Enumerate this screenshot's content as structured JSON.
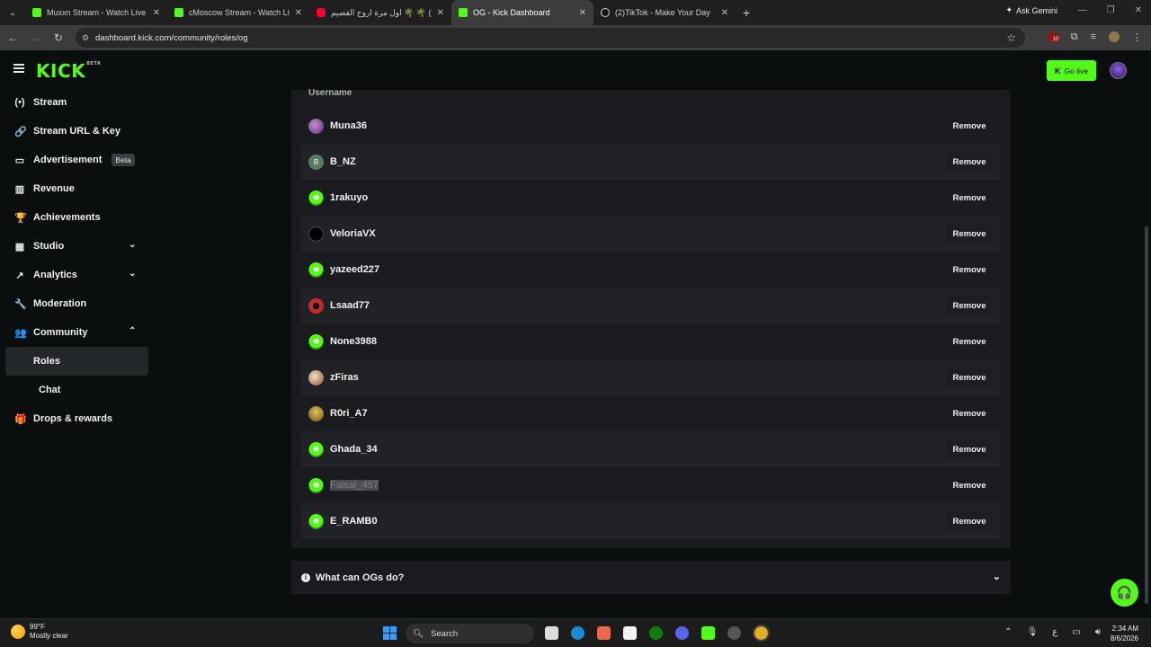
{
  "browser": {
    "tabs": [
      {
        "title": "Muxxn Stream - Watch Live on",
        "favicon": "kick",
        "active": false
      },
      {
        "title": "cMoscow Stream - Watch Live o",
        "favicon": "kick",
        "active": false
      },
      {
        "title": "اول مرة اروح القصيم ‎🌴 🌴 ‎(1)",
        "favicon": "yt",
        "active": false
      },
      {
        "title": "OG - Kick Dashboard",
        "favicon": "kick",
        "active": true
      },
      {
        "title": "(2)TikTok - Make Your Day",
        "favicon": "tt",
        "active": false
      }
    ],
    "new_tab": "+",
    "gemini_label": "Ask Gemini",
    "url": "dashboard.kick.com/community/roles/og",
    "extension_badge": "10"
  },
  "app": {
    "logo_text": "KICK",
    "logo_badge": "BETA",
    "go_live_label": "Go live",
    "sidebar": [
      {
        "label": "Stream",
        "icon": "broadcast-icon",
        "glyph": "(•)"
      },
      {
        "label": "Stream URL & Key",
        "icon": "link-icon",
        "glyph": "🔗"
      },
      {
        "label": "Advertisement",
        "icon": "ad-window-icon",
        "glyph": "▭",
        "badge": "Beta"
      },
      {
        "label": "Revenue",
        "icon": "bar-chart-icon",
        "glyph": "▥"
      },
      {
        "label": "Achievements",
        "icon": "trophy-icon",
        "glyph": "🏆"
      },
      {
        "label": "Studio",
        "icon": "studio-icon",
        "glyph": "▦",
        "chevron": "down"
      },
      {
        "label": "Analytics",
        "icon": "analytics-icon",
        "glyph": "↗",
        "chevron": "down"
      },
      {
        "label": "Moderation",
        "icon": "wrench-icon",
        "glyph": "🔧"
      },
      {
        "label": "Community",
        "icon": "community-icon",
        "glyph": "👥",
        "chevron": "up"
      }
    ],
    "community_sub": [
      {
        "label": "Roles",
        "active": true
      },
      {
        "label": "Chat",
        "active": false
      }
    ],
    "sidebar_tail": {
      "label": "Drops & rewards",
      "icon": "gift-icon",
      "glyph": "🎁"
    },
    "table": {
      "column_header": "Username",
      "remove_label": "Remove",
      "rows": [
        {
          "username": "Muna36",
          "avatar": "purple"
        },
        {
          "username": "B_NZ",
          "avatar": "b",
          "initial": "B"
        },
        {
          "username": "1rakuyo",
          "avatar": "def"
        },
        {
          "username": "VeloriaVX",
          "avatar": "dark"
        },
        {
          "username": "yazeed227",
          "avatar": "def"
        },
        {
          "username": "Lsaad77",
          "avatar": "red"
        },
        {
          "username": "None3988",
          "avatar": "def"
        },
        {
          "username": "zFiras",
          "avatar": "fire"
        },
        {
          "username": "R0ri_A7",
          "avatar": "gold"
        },
        {
          "username": "Ghada_34",
          "avatar": "def"
        },
        {
          "username": "Faisal_457",
          "avatar": "def",
          "selected": true
        },
        {
          "username": "E_RAMB0",
          "avatar": "def"
        }
      ]
    },
    "faq_label": "What can OGs do?",
    "colors": {
      "accent": "#53fc18",
      "panel": "#191b1f",
      "background": "#0b0e0f"
    }
  },
  "taskbar": {
    "weather_temp": "99°F",
    "weather_desc": "Mostly clear",
    "search_label": "Search",
    "time": "2:34 AM",
    "date": "8/6/2026",
    "lang": "ع"
  }
}
